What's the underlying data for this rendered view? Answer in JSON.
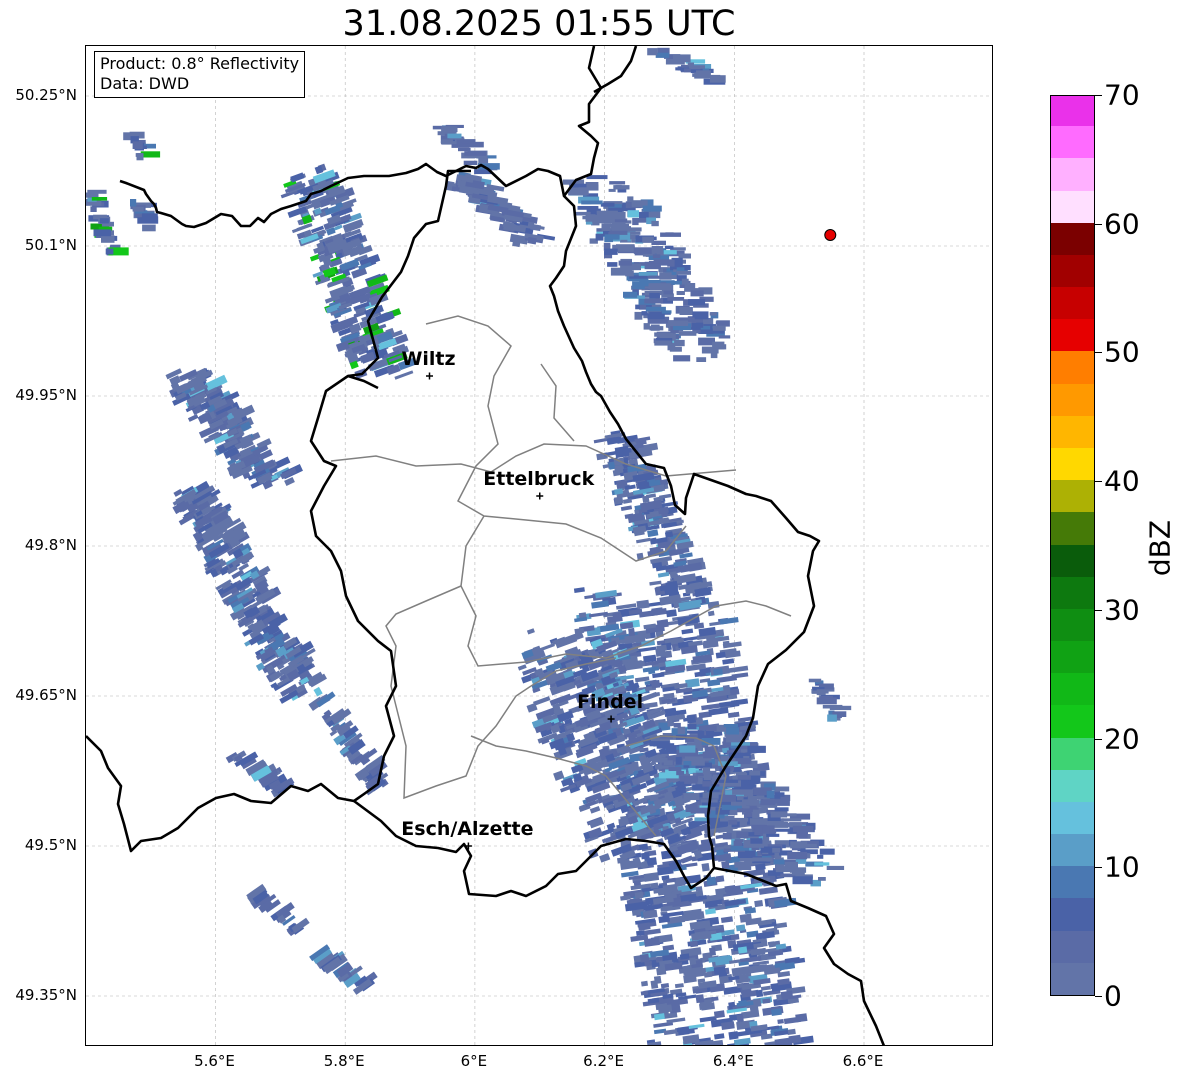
{
  "title": "31.08.2025 01:55 UTC",
  "info_box": {
    "line1": "Product: 0.8° Reflectivity",
    "line2": "Data: DWD"
  },
  "map_extent": {
    "lon_min": 5.4,
    "lon_max": 6.8,
    "lat_min": 49.3,
    "lat_max": 50.3
  },
  "lat_ticks": [
    {
      "value": 50.25,
      "label": "50.25°N"
    },
    {
      "value": 50.1,
      "label": "50.1°N"
    },
    {
      "value": 49.95,
      "label": "49.95°N"
    },
    {
      "value": 49.8,
      "label": "49.8°N"
    },
    {
      "value": 49.65,
      "label": "49.65°N"
    },
    {
      "value": 49.5,
      "label": "49.5°N"
    },
    {
      "value": 49.35,
      "label": "49.35°N"
    }
  ],
  "lon_ticks": [
    {
      "value": 5.6,
      "label": "5.6°E"
    },
    {
      "value": 5.8,
      "label": "5.8°E"
    },
    {
      "value": 6.0,
      "label": "6°E"
    },
    {
      "value": 6.2,
      "label": "6.2°E"
    },
    {
      "value": 6.4,
      "label": "6.4°E"
    },
    {
      "value": 6.6,
      "label": "6.6°E"
    }
  ],
  "cities": [
    {
      "name": "Wiltz",
      "lon": 5.93,
      "lat": 49.97
    },
    {
      "name": "Ettelbruck",
      "lon": 6.1,
      "lat": 49.85
    },
    {
      "name": "Findel",
      "lon": 6.21,
      "lat": 49.627
    },
    {
      "name": "Esch/Alzette",
      "lon": 5.99,
      "lat": 49.5
    }
  ],
  "radar_site": {
    "lon": 6.548,
    "lat": 50.111,
    "color": "#e60000"
  },
  "border_color": "#000000",
  "canton_color": "#808080",
  "colorbar": {
    "unit": "dBZ",
    "min": 0,
    "max": 70,
    "tick_labels": [
      {
        "value": 0,
        "label": "0"
      },
      {
        "value": 10,
        "label": "10"
      },
      {
        "value": 20,
        "label": "20"
      },
      {
        "value": 30,
        "label": "30"
      },
      {
        "value": 40,
        "label": "40"
      },
      {
        "value": 50,
        "label": "50"
      },
      {
        "value": 60,
        "label": "60"
      },
      {
        "value": 70,
        "label": "70"
      }
    ],
    "colors": [
      "#6274a8",
      "#5a6ba6",
      "#4a62a7",
      "#4a78b2",
      "#5a9ec8",
      "#65c1dd",
      "#5fd4c5",
      "#3ed373",
      "#13c71a",
      "#11b817",
      "#10a214",
      "#0f8e12",
      "#0d790f",
      "#0a5c0b",
      "#457a07",
      "#adb104",
      "#ffd800",
      "#ffb600",
      "#ff9900",
      "#ff7e00",
      "#e60000",
      "#c70000",
      "#a10000",
      "#7b0000",
      "#ffdfff",
      "#ffb0ff",
      "#ff6bff",
      "#ea31ea"
    ]
  }
}
